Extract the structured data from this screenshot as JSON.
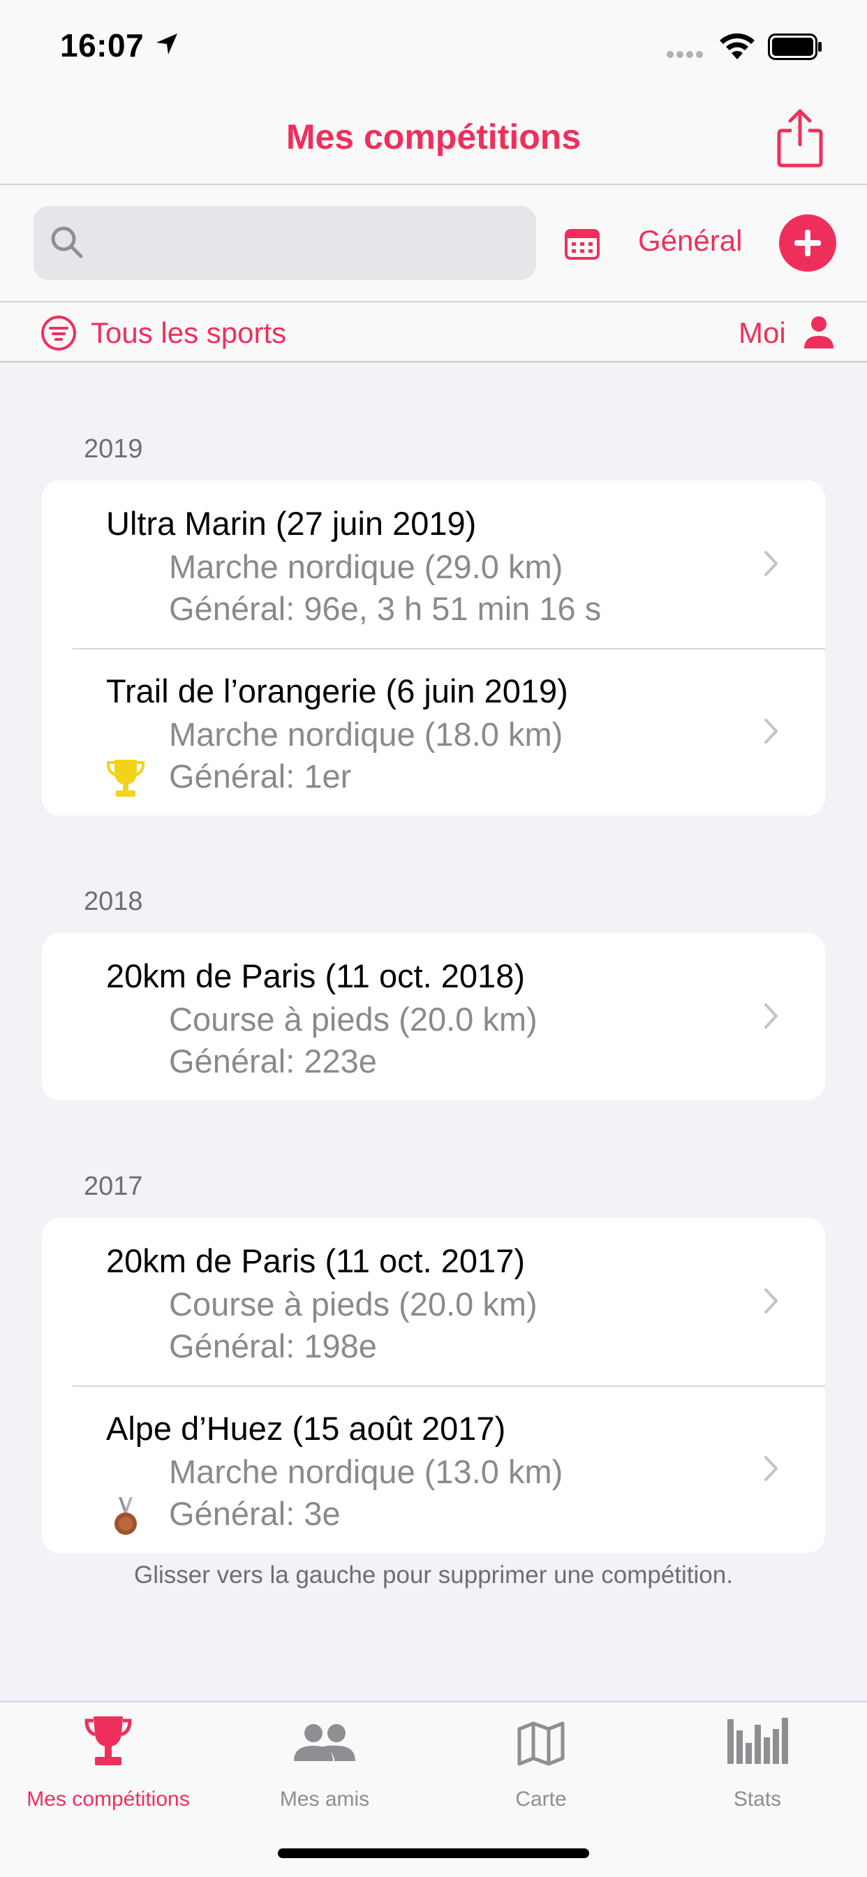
{
  "status_bar": {
    "time": "16:07"
  },
  "nav": {
    "title": "Mes compétitions"
  },
  "toolbar": {
    "search_placeholder": "",
    "general_label": "Général"
  },
  "filter": {
    "sports_label": "Tous les sports",
    "me_label": "Moi"
  },
  "sections": [
    {
      "year": "2019",
      "items": [
        {
          "title": "Ultra Marin (27 juin 2019)",
          "sport": "Marche nordique (29.0 km)",
          "result": "Général: 96e, 3 h 51 min 16 s",
          "badge": ""
        },
        {
          "title": "Trail de l’orangerie (6 juin 2019)",
          "sport": "Marche nordique (18.0 km)",
          "result": "Général: 1er",
          "badge": "trophy-icon"
        }
      ]
    },
    {
      "year": "2018",
      "items": [
        {
          "title": "20km de Paris (11 oct. 2018)",
          "sport": "Course à pieds (20.0 km)",
          "result": "Général: 223e",
          "badge": ""
        }
      ]
    },
    {
      "year": "2017",
      "items": [
        {
          "title": "20km de Paris (11 oct. 2017)",
          "sport": "Course à pieds (20.0 km)",
          "result": "Général: 198e",
          "badge": ""
        },
        {
          "title": "Alpe d’Huez (15 août 2017)",
          "sport": "Marche nordique (13.0 km)",
          "result": "Général: 3e",
          "badge": "bronze-medal-icon"
        }
      ]
    }
  ],
  "footer_note": "Glisser vers la gauche pour supprimer une compétition.",
  "tabs": [
    {
      "label": "Mes compétitions",
      "icon": "trophy-icon",
      "active": true
    },
    {
      "label": "Mes amis",
      "icon": "people-icon",
      "active": false
    },
    {
      "label": "Carte",
      "icon": "map-icon",
      "active": false
    },
    {
      "label": "Stats",
      "icon": "bar-chart-icon",
      "active": false
    }
  ],
  "colors": {
    "accent": "#ef2f5b",
    "background": "#f2f2f7",
    "secondary_text": "#8a8a8e",
    "trophy": "#f3d21b",
    "bronze": "#a0522d"
  }
}
